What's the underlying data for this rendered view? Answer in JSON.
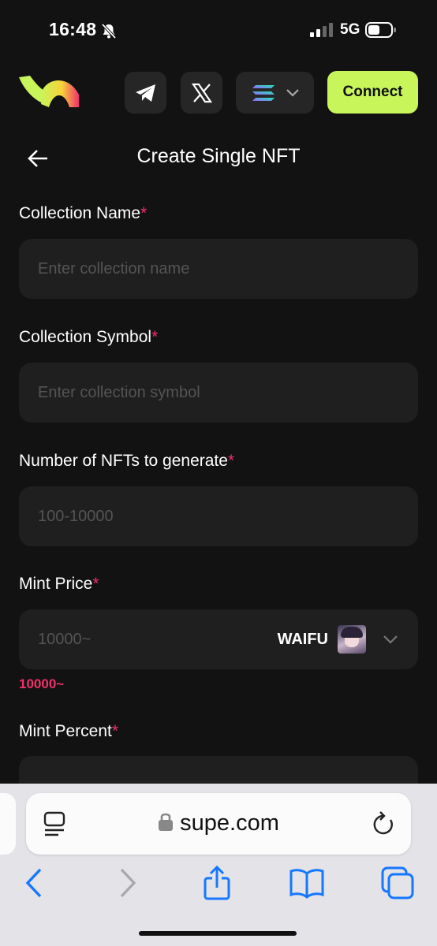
{
  "status": {
    "time": "16:48",
    "network": "5G"
  },
  "header": {
    "connect_label": "Connect",
    "chain_icon": "solana-icon"
  },
  "page": {
    "title": "Create Single NFT"
  },
  "form": {
    "collection_name": {
      "label": "Collection Name",
      "required": "*",
      "placeholder": "Enter collection name"
    },
    "collection_symbol": {
      "label": "Collection Symbol",
      "required": "*",
      "placeholder": "Enter collection symbol"
    },
    "num_nfts": {
      "label": "Number of NFTs to generate",
      "required": "*",
      "placeholder": "100-10000"
    },
    "mint_price": {
      "label": "Mint Price",
      "required": "*",
      "placeholder": "10000~",
      "token": "WAIFU",
      "error": "10000~"
    },
    "mint_percent": {
      "label": "Mint Percent",
      "required": "*"
    }
  },
  "browser": {
    "url": "supe.com"
  },
  "colors": {
    "accent": "#c8f55a",
    "required": "#f0306b",
    "background": "#121212",
    "field": "#1f1f1f"
  }
}
